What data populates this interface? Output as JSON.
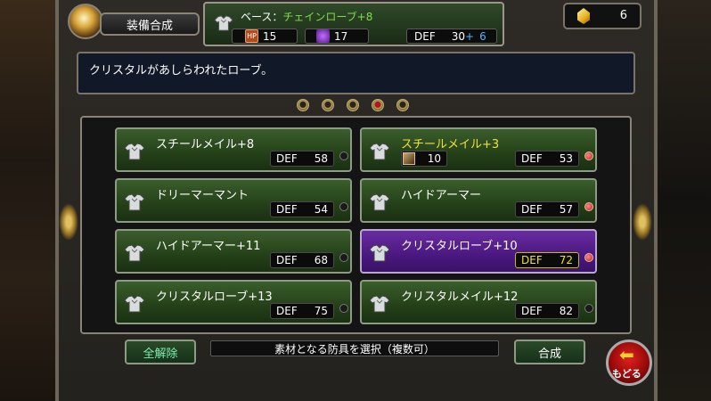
{
  "header": {
    "title": "装備合成",
    "base_label": "ベース：",
    "base_name": "チェインローブ+8",
    "hp_icon_text": "HP",
    "hp": "15",
    "mp": "17",
    "def_label": "DEF",
    "def_value": "30",
    "def_plus": "+",
    "def_bonus": "6",
    "crystal_count": "6"
  },
  "description": "クリスタルがあしらわれたローブ。",
  "pagination": {
    "pages": 5,
    "active": 4
  },
  "items": [
    {
      "name": "スチールメイル+8",
      "def_label": "DEF",
      "def": "58",
      "marker": "none"
    },
    {
      "name": "スチールメイル+3",
      "def_label": "DEF",
      "def": "53",
      "material_count": "10",
      "marker": "red",
      "color": "#f0e038"
    },
    {
      "name": "ドリーマーマント",
      "def_label": "DEF",
      "def": "54",
      "marker": "none"
    },
    {
      "name": "ハイドアーマー",
      "def_label": "DEF",
      "def": "57",
      "marker": "red"
    },
    {
      "name": "ハイドアーマー+11",
      "def_label": "DEF",
      "def": "68",
      "marker": "none"
    },
    {
      "name": "クリスタルローブ+10",
      "def_label": "DEF",
      "def": "72",
      "marker": "red",
      "selected": true
    },
    {
      "name": "クリスタルローブ+13",
      "def_label": "DEF",
      "def": "75",
      "marker": "none"
    },
    {
      "name": "クリスタルメイル+12",
      "def_label": "DEF",
      "def": "82",
      "marker": "none"
    }
  ],
  "footer": {
    "clear_all": "全解除",
    "hint": "素材となる防具を選択（複数可）",
    "combine": "合成",
    "back": "もどる"
  },
  "colors": {
    "item_bg": "#2f4f24",
    "selected_bg": "#5a2090",
    "highlight_text": "#f0e038",
    "bonus_blue": "#4fb4ff",
    "name_green": "#7fdc50"
  }
}
